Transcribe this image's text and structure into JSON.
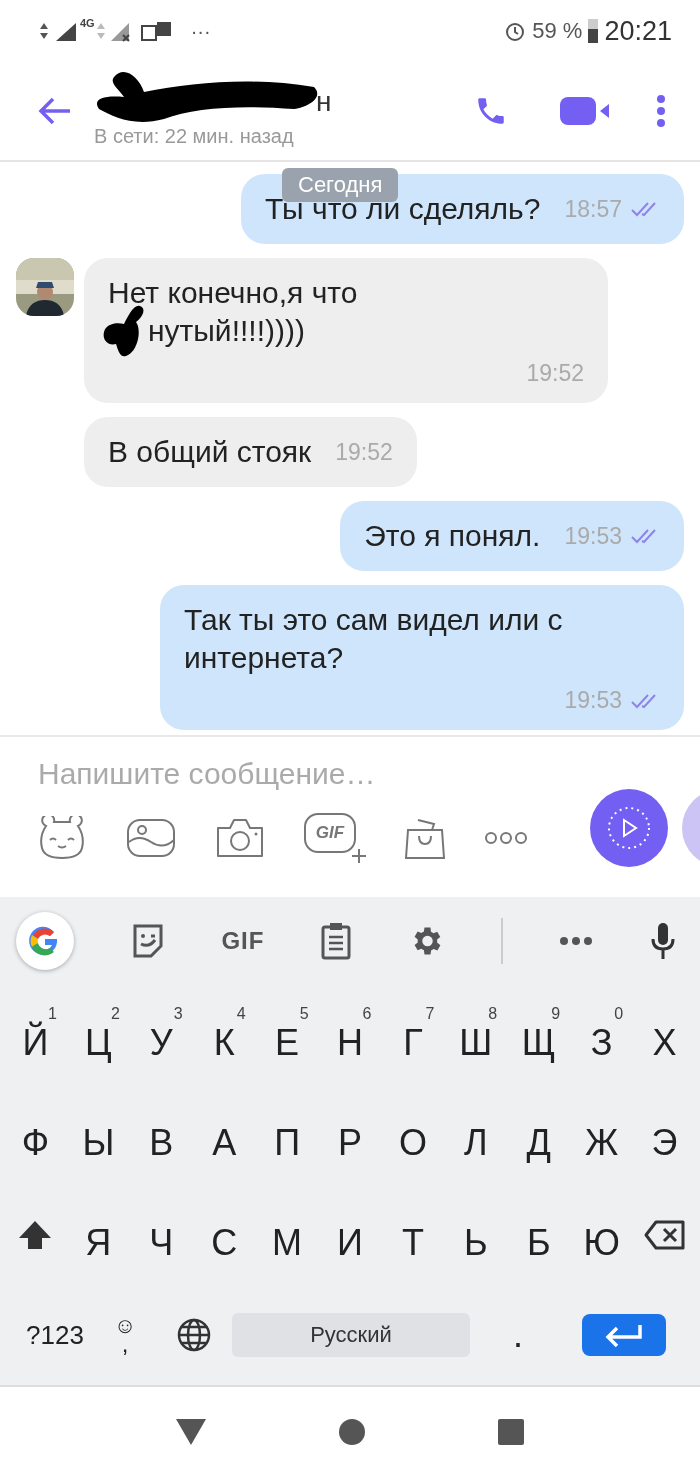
{
  "status_bar": {
    "network": "4G",
    "more": "···",
    "battery_text": "59 %",
    "time": "20:21"
  },
  "header": {
    "name_visible": "н",
    "name_redacted": true,
    "status": "В сети: 22 мин. назад"
  },
  "date_chip": "Сегодня",
  "messages": [
    {
      "kind": "outgoing",
      "lines": [
        "Ты что ли сделяль?"
      ],
      "time": "18:57",
      "read": true,
      "inline_time": true
    },
    {
      "kind": "incoming",
      "avatar": true,
      "lines": [
        "Нет конечно,я что",
        "нутый!!!!))))"
      ],
      "scribble": true,
      "time": "19:52",
      "inline_time": false
    },
    {
      "kind": "incoming",
      "avatar": false,
      "lines": [
        "В общий стояк"
      ],
      "time": "19:52",
      "inline_time": true
    },
    {
      "kind": "outgoing",
      "lines": [
        "Это я понял."
      ],
      "time": "19:53",
      "read": true,
      "inline_time": true
    },
    {
      "kind": "outgoing",
      "lines": [
        "Так ты это сам видел или с",
        "интернета?"
      ],
      "time": "19:53",
      "read": true,
      "inline_time": false
    }
  ],
  "composer": {
    "placeholder": "Напишите сообщение…",
    "gif_label": "GIF"
  },
  "keyboard_toolbar": {
    "gif": "GIF"
  },
  "keyboard_rows": [
    [
      {
        "kind": "char",
        "label": "Й",
        "hint": "1"
      },
      {
        "kind": "char",
        "label": "Ц",
        "hint": "2"
      },
      {
        "kind": "char",
        "label": "У",
        "hint": "3"
      },
      {
        "kind": "char",
        "label": "К",
        "hint": "4"
      },
      {
        "kind": "char",
        "label": "Е",
        "hint": "5"
      },
      {
        "kind": "char",
        "label": "Н",
        "hint": "6"
      },
      {
        "kind": "char",
        "label": "Г",
        "hint": "7"
      },
      {
        "kind": "char",
        "label": "Ш",
        "hint": "8"
      },
      {
        "kind": "char",
        "label": "Щ",
        "hint": "9"
      },
      {
        "kind": "char",
        "label": "З",
        "hint": "0"
      },
      {
        "kind": "char",
        "label": "Х"
      }
    ],
    [
      {
        "kind": "char",
        "label": "Ф"
      },
      {
        "kind": "char",
        "label": "Ы"
      },
      {
        "kind": "char",
        "label": "В"
      },
      {
        "kind": "char",
        "label": "А"
      },
      {
        "kind": "char",
        "label": "П"
      },
      {
        "kind": "char",
        "label": "Р"
      },
      {
        "kind": "char",
        "label": "О"
      },
      {
        "kind": "char",
        "label": "Л"
      },
      {
        "kind": "char",
        "label": "Д"
      },
      {
        "kind": "char",
        "label": "Ж"
      },
      {
        "kind": "char",
        "label": "Э"
      }
    ],
    [
      {
        "kind": "shift"
      },
      {
        "kind": "char",
        "label": "Я"
      },
      {
        "kind": "char",
        "label": "Ч"
      },
      {
        "kind": "char",
        "label": "С"
      },
      {
        "kind": "char",
        "label": "М"
      },
      {
        "kind": "char",
        "label": "И"
      },
      {
        "kind": "char",
        "label": "Т"
      },
      {
        "kind": "char",
        "label": "Ь"
      },
      {
        "kind": "char",
        "label": "Б"
      },
      {
        "kind": "char",
        "label": "Ю"
      },
      {
        "kind": "backspace"
      }
    ]
  ],
  "keyboard_bottom": {
    "symbols": "?123",
    "emoji_hint": "☺",
    "comma": ",",
    "space": "Русский",
    "period": "."
  }
}
